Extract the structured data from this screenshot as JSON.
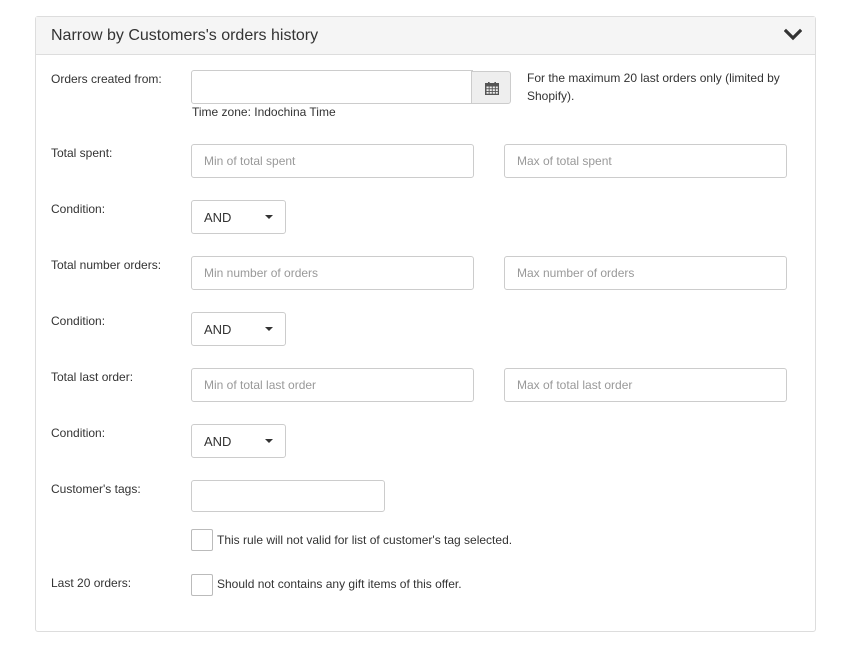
{
  "panel": {
    "title": "Narrow by Customers's orders history",
    "toggle_icon": "chevron-down-icon"
  },
  "orders_created": {
    "label": "Orders created from:",
    "value": "",
    "calendar_icon": "calendar-icon",
    "timezone": "Time zone: Indochina Time",
    "note_line1": "For the maximum 20 last orders only (limited by",
    "note_line2": "Shopify)."
  },
  "total_spent": {
    "label": "Total spent:",
    "min_placeholder": "Min of total spent",
    "max_placeholder": "Max of total spent"
  },
  "condition1": {
    "label": "Condition:",
    "value": "AND"
  },
  "total_orders": {
    "label": "Total number orders:",
    "min_placeholder": "Min number of orders",
    "max_placeholder": "Max number of orders"
  },
  "condition2": {
    "label": "Condition:",
    "value": "AND"
  },
  "total_last_order": {
    "label": "Total last order:",
    "min_placeholder": "Min of total last order",
    "max_placeholder": "Max of total last order"
  },
  "condition3": {
    "label": "Condition:",
    "value": "AND"
  },
  "customer_tags": {
    "label": "Customer's tags:",
    "value": "",
    "checkbox_label": "This rule will not valid for list of customer's tag selected.",
    "checked": false
  },
  "last_orders": {
    "label": "Last 20 orders:",
    "checkbox_label": "Should not contains any gift items of this offer.",
    "checked": false
  }
}
